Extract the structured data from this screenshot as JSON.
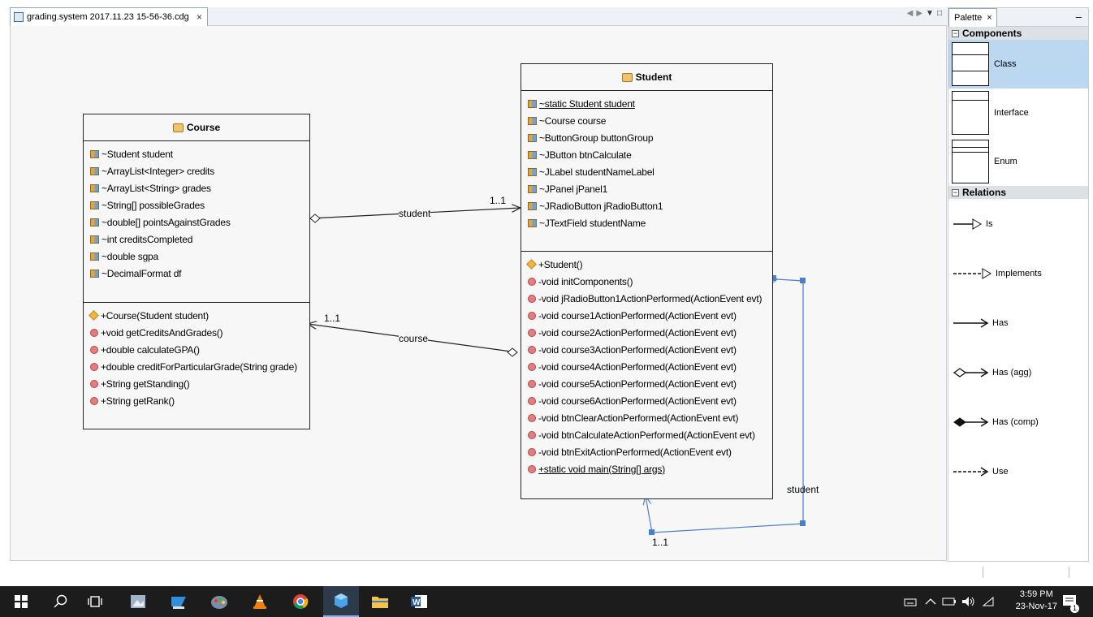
{
  "editor": {
    "tab_title": "grading.system 2017.11.23 15-56-36.cdg",
    "tab_close": "×"
  },
  "diagram": {
    "course": {
      "name": "Course",
      "fields": [
        "~Student student",
        "~ArrayList<Integer> credits",
        "~ArrayList<String> grades",
        "~String[] possibleGrades",
        "~double[] pointsAgainstGrades",
        "~int creditsCompleted",
        "~double sgpa",
        "~DecimalFormat df"
      ],
      "methods": [
        "+Course(Student student)",
        "+void getCreditsAndGrades()",
        "+double calculateGPA()",
        "+double creditForParticularGrade(String grade)",
        "+String getStanding()",
        "+String getRank()"
      ]
    },
    "student": {
      "name": "Student",
      "fields": [
        "~static Student student",
        "~Course course",
        "~ButtonGroup buttonGroup",
        "~JButton btnCalculate",
        "~JLabel studentNameLabel",
        "~JPanel jPanel1",
        "~JRadioButton jRadioButton1",
        "~JTextField studentName"
      ],
      "methods": [
        "+Student()",
        "-void initComponents()",
        "-void jRadioButton1ActionPerformed(ActionEvent evt)",
        "-void course1ActionPerformed(ActionEvent evt)",
        "-void course2ActionPerformed(ActionEvent evt)",
        "-void course3ActionPerformed(ActionEvent evt)",
        "-void course4ActionPerformed(ActionEvent evt)",
        "-void course5ActionPerformed(ActionEvent evt)",
        "-void course6ActionPerformed(ActionEvent evt)",
        "-void btnClearActionPerformed(ActionEvent evt)",
        "-void btnCalculateActionPerformed(ActionEvent evt)",
        "-void btnExitActionPerformed(ActionEvent evt)",
        "+static void main(String[] args)"
      ]
    },
    "relations": {
      "course_to_student_label": "student",
      "course_to_student_mult": "1..1",
      "student_to_course_label": "course",
      "student_to_course_mult": "1..1",
      "self_label": "student",
      "self_mult": "1..1"
    }
  },
  "palette": {
    "title": "Palette",
    "close": "×",
    "minimize": "–",
    "components_header": "Components",
    "components": [
      "Class",
      "Interface",
      "Enum"
    ],
    "relations_header": "Relations",
    "relations": [
      "Is",
      "Implements",
      "Has",
      "Has (agg)",
      "Has (comp)",
      "Use"
    ]
  },
  "taskbar": {
    "time": "3:59 PM",
    "date": "23-Nov-17",
    "notification_count": "1"
  }
}
